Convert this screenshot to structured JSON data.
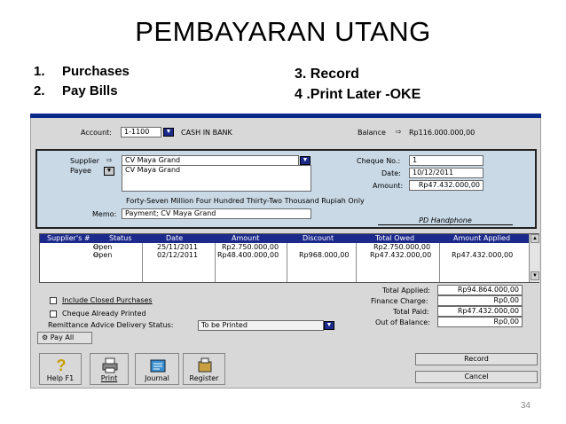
{
  "slide": {
    "title": "PEMBAYARAN UTANG",
    "left_list": [
      {
        "num": "1.",
        "text": "Purchases"
      },
      {
        "num": "2.",
        "text": "Pay  Bills"
      }
    ],
    "right_list": [
      "3. Record",
      "4 .Print Later -OKE"
    ],
    "page_number": "34"
  },
  "form": {
    "account_label": "Account:",
    "account_code": "1-1100",
    "account_name": "CASH IN BANK",
    "balance_label": "Balance",
    "balance_value": "Rp116.000.000,00",
    "supplier_label": "Supplier",
    "supplier_value": "CV Maya Grand",
    "payee_label": "Payee",
    "payee_value": "CV Maya Grand",
    "cheque_no_label": "Cheque No.:",
    "cheque_no_value": "1",
    "date_label": "Date:",
    "date_value": "10/12/2011",
    "amount_label": "Amount:",
    "amount_value": "Rp47.432.000,00",
    "amount_words": "Forty-Seven Million Four Hundred Thirty-Two Thousand Rupiah  Only",
    "memo_label": "Memo:",
    "memo_value": "Payment; CV Maya Grand",
    "signature": "PD Handphone"
  },
  "grid": {
    "headers": [
      "Supplier's #",
      "Status",
      "Date",
      "Amount",
      "Discount",
      "Total Owed",
      "Amount Applied"
    ],
    "rows": [
      {
        "supplier_no": "",
        "status": "Open",
        "date": "25/11/2011",
        "amount": "Rp2.750.000,00",
        "discount": "",
        "total_owed": "Rp2.750.000,00",
        "applied": ""
      },
      {
        "supplier_no": "",
        "status": "Open",
        "date": "02/12/2011",
        "amount": "Rp48.400.000,00",
        "discount": "Rp968.000,00",
        "total_owed": "Rp47.432.000,00",
        "applied": "Rp47.432.000,00"
      }
    ]
  },
  "options": {
    "include_closed": "Include Closed Purchases",
    "cheque_printed": "Cheque Already Printed",
    "remittance_label": "Remittance Advice Delivery Status:",
    "remittance_value": "To be Printed",
    "pay_all": "Pay All"
  },
  "totals": {
    "applied_label": "Total Applied:",
    "applied_value": "Rp94.864.000,00",
    "finance_label": "Finance Charge:",
    "finance_value": "Rp0,00",
    "paid_label": "Total Paid:",
    "paid_value": "Rp47.432.000,00",
    "out_label": "Out of Balance:",
    "out_value": "Rp0,00"
  },
  "toolbar": {
    "help": "Help F1",
    "print": "Print",
    "journal": "Journal",
    "register": "Register",
    "record": "Record",
    "cancel": "Cancel"
  },
  "colors": {
    "title_bar": "#0a2a8a",
    "grid_header": "#1c2a8c",
    "cheque_panel": "#c9d9e6"
  },
  "icons": [
    "arrow-right-icon",
    "dropdown-arrow-icon",
    "help-question-icon",
    "printer-icon",
    "journal-icon",
    "register-icon",
    "pay-all-icon"
  ]
}
